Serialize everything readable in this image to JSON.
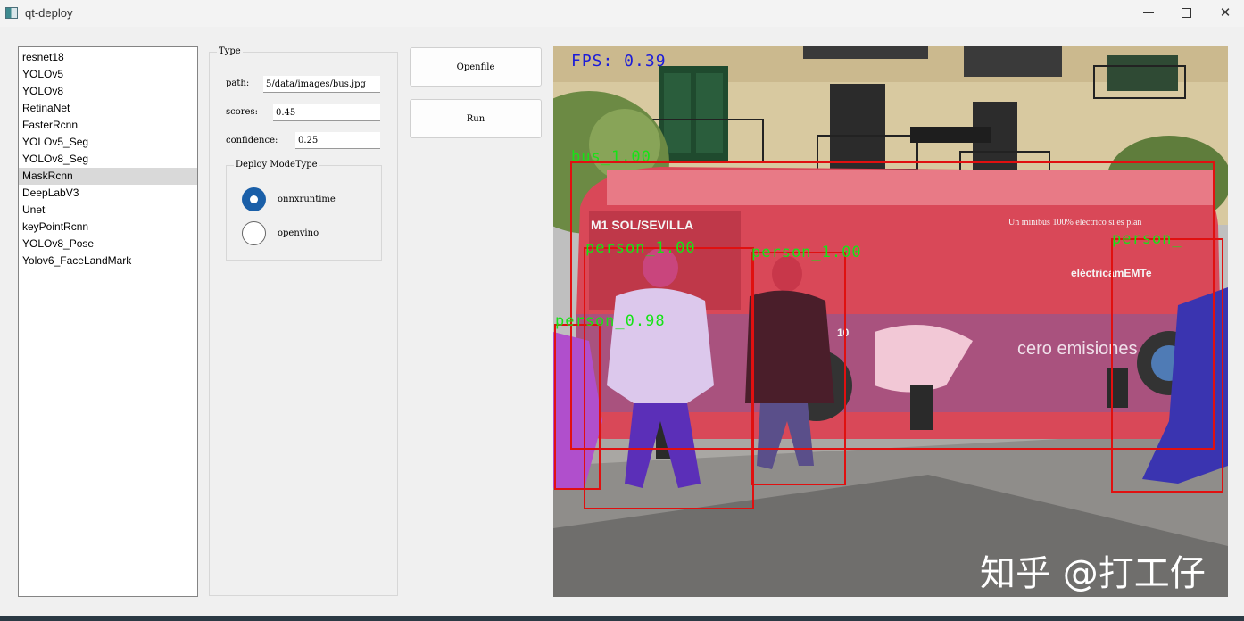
{
  "window": {
    "title": "qt-deploy",
    "minimize_icon": "minimize-icon",
    "maximize_icon": "maximize-icon",
    "close_glyph": "✕"
  },
  "models": [
    "resnet18",
    "YOLOv5",
    "YOLOv8",
    "RetinaNet",
    "FasterRcnn",
    "YOLOv5_Seg",
    "YOLOv8_Seg",
    "MaskRcnn",
    "DeepLabV3",
    "Unet",
    "keyPointRcnn",
    "YOLOv8_Pose",
    "Yolov6_FaceLandMark"
  ],
  "selected_model": "MaskRcnn",
  "type_group": {
    "title": "Type",
    "path_label": "path:",
    "path_value": "5/data/images/bus.jpg",
    "scores_label": "scores:",
    "scores_value": "0.45",
    "confidence_label": "confidence:",
    "confidence_value": "0.25"
  },
  "deploy_mode": {
    "title": "Deploy ModeType",
    "options": [
      "onnxruntime",
      "openvino"
    ],
    "selected": "onnxruntime"
  },
  "buttons": {
    "openfile": "Openfile",
    "run": "Run"
  },
  "display": {
    "fps": "FPS: 0.39",
    "detections": [
      {
        "label": "bus_1.00"
      },
      {
        "label": "person_1.00"
      },
      {
        "label": "person_1.00"
      },
      {
        "label": "person_0.98"
      },
      {
        "label": "person_"
      }
    ],
    "watermark": "知乎 @打工仔",
    "bus_text": {
      "route": "M1 SOL/SEVILLA",
      "slogan": "Un minibús 100% eléctrico si es plan",
      "brand": "eléctricamEMTe",
      "side": "cero emisiones",
      "number": "10"
    }
  },
  "colors": {
    "box": "#e01010",
    "label": "#16e316",
    "fps": "#1c1cd8",
    "radio_checked": "#1a5fa8",
    "selection": "#d9d9d9"
  }
}
